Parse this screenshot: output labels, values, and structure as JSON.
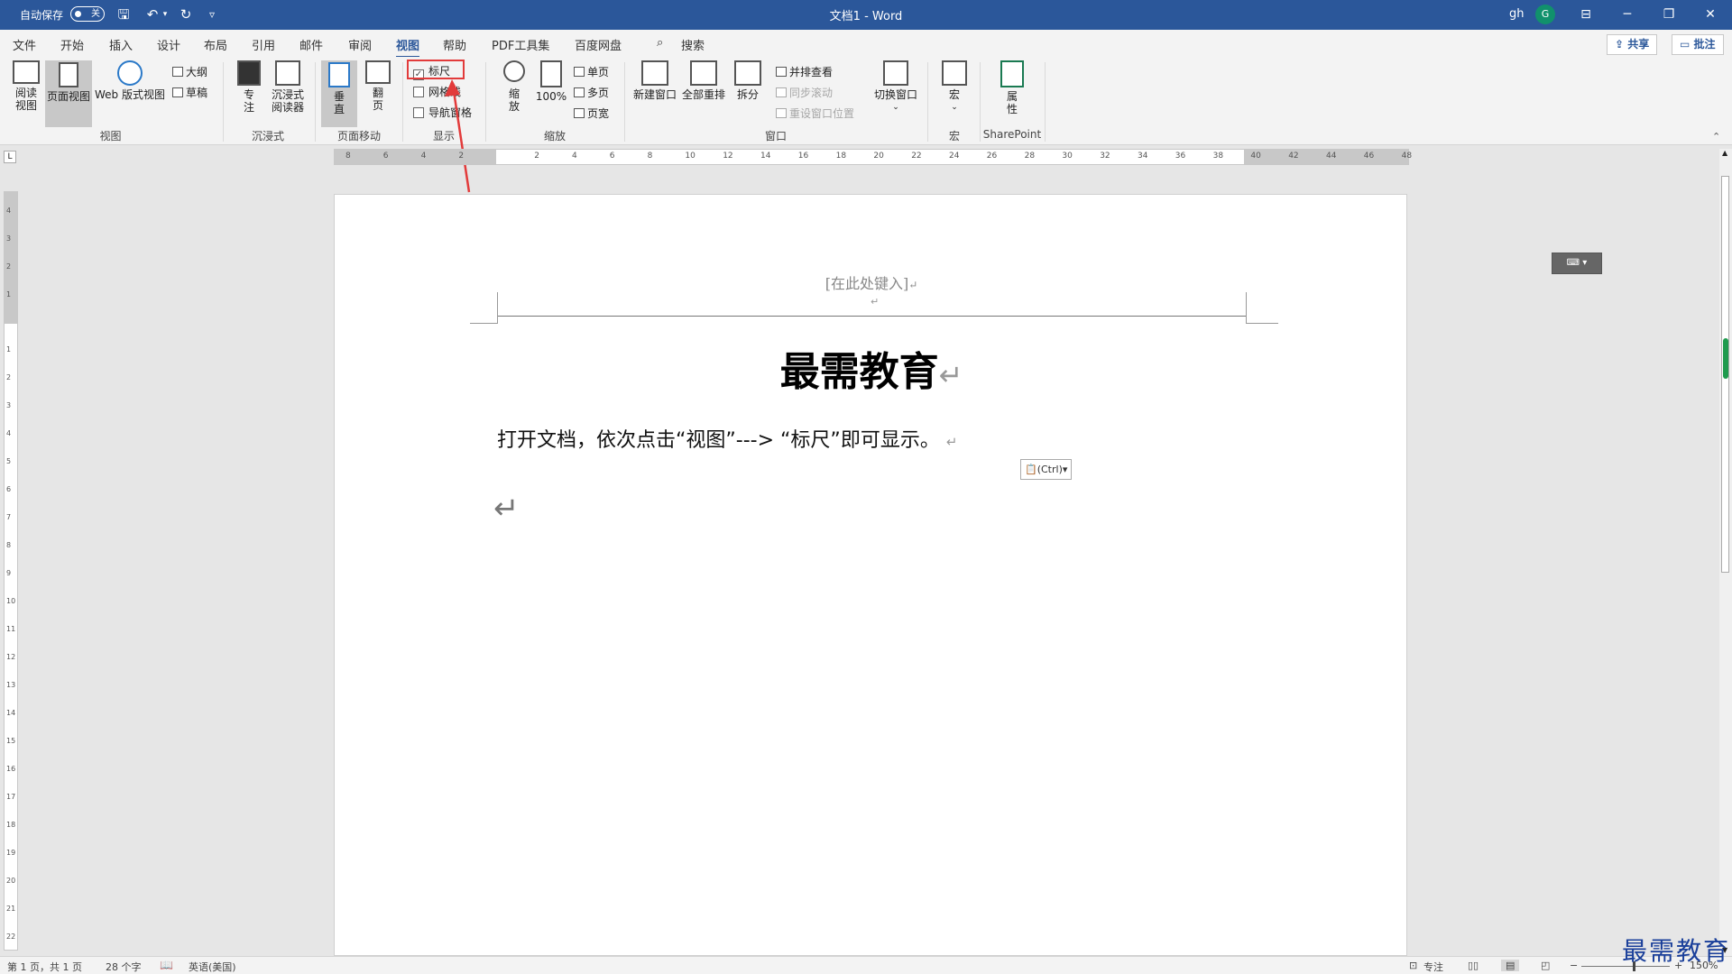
{
  "titlebar": {
    "autosave_label": "自动保存",
    "autosave_state": "关",
    "doc_title": "文档1 - Word",
    "user_name": "gh",
    "avatar_initial": "G",
    "qat_customize": "▿"
  },
  "menu_tabs": [
    "文件",
    "开始",
    "插入",
    "设计",
    "布局",
    "引用",
    "邮件",
    "审阅",
    "视图",
    "帮助",
    "PDF工具集",
    "百度网盘"
  ],
  "active_tab": "视图",
  "search_label": "搜索",
  "share_label": "共享",
  "comment_label": "批注",
  "ribbon": {
    "views": {
      "group_label": "视图",
      "read_mode": "阅读视图",
      "read_mode_l1": "阅读",
      "read_mode_l2": "视图",
      "print_layout": "页面视图",
      "web_layout": "Web 版式视图",
      "outline": "大纲",
      "draft": "草稿"
    },
    "immersive": {
      "group_label": "沉浸式",
      "focus_l1": "专",
      "focus_l2": "注",
      "reader_l1": "沉浸式",
      "reader_l2": "阅读器"
    },
    "page_movement": {
      "group_label": "页面移动",
      "vertical_l1": "垂",
      "vertical_l2": "直",
      "side_l1": "翻",
      "side_l2": "页"
    },
    "show": {
      "group_label": "显示",
      "ruler": "标尺",
      "ruler_checked": true,
      "gridlines": "网格线",
      "gridlines_checked": false,
      "nav_pane": "导航窗格",
      "nav_pane_checked": false
    },
    "zoom": {
      "group_label": "缩放",
      "zoom_l1": "缩",
      "zoom_l2": "放",
      "hundred": "100%",
      "one_page": "单页",
      "multi_page": "多页",
      "page_width": "页宽"
    },
    "window": {
      "group_label": "窗口",
      "new_window": "新建窗口",
      "arrange_all": "全部重排",
      "split": "拆分",
      "side_by_side": "并排查看",
      "sync_scroll": "同步滚动",
      "reset_position": "重设窗口位置",
      "switch_windows": "切换窗口"
    },
    "macros": {
      "group_label": "宏",
      "macros": "宏"
    },
    "sharepoint": {
      "group_label": "SharePoint",
      "properties_l1": "属",
      "properties_l2": "性"
    }
  },
  "ruler_h_labels": [
    "8",
    "6",
    "4",
    "2",
    "2",
    "4",
    "6",
    "8",
    "10",
    "12",
    "14",
    "16",
    "18",
    "20",
    "22",
    "24",
    "26",
    "28",
    "30",
    "32",
    "34",
    "36",
    "38",
    "40",
    "42",
    "44",
    "46",
    "48"
  ],
  "ruler_v_labels": [
    "4",
    "3",
    "2",
    "1",
    "1",
    "2",
    "3",
    "4",
    "5",
    "6",
    "7",
    "8",
    "9",
    "10",
    "11",
    "12",
    "13",
    "14",
    "15",
    "16",
    "17",
    "18",
    "19",
    "20",
    "21",
    "22"
  ],
  "document": {
    "header_placeholder": "[在此处键入]",
    "title": "最需教育",
    "body": "打开文档，依次点击“视图”---> “标尺”即可显示。",
    "paste_options": "(Ctrl)",
    "return_mark": "↵"
  },
  "statusbar": {
    "page_info": "第 1 页，共 1 页",
    "word_count": "28 个字",
    "language": "英语(美国)",
    "focus": "专注",
    "zoom_level": "150%"
  },
  "watermark": "最需教育",
  "colors": {
    "title_bar": "#2b579a",
    "annotation_red": "#e23b3b",
    "scroll_green": "#1f9b4e"
  }
}
